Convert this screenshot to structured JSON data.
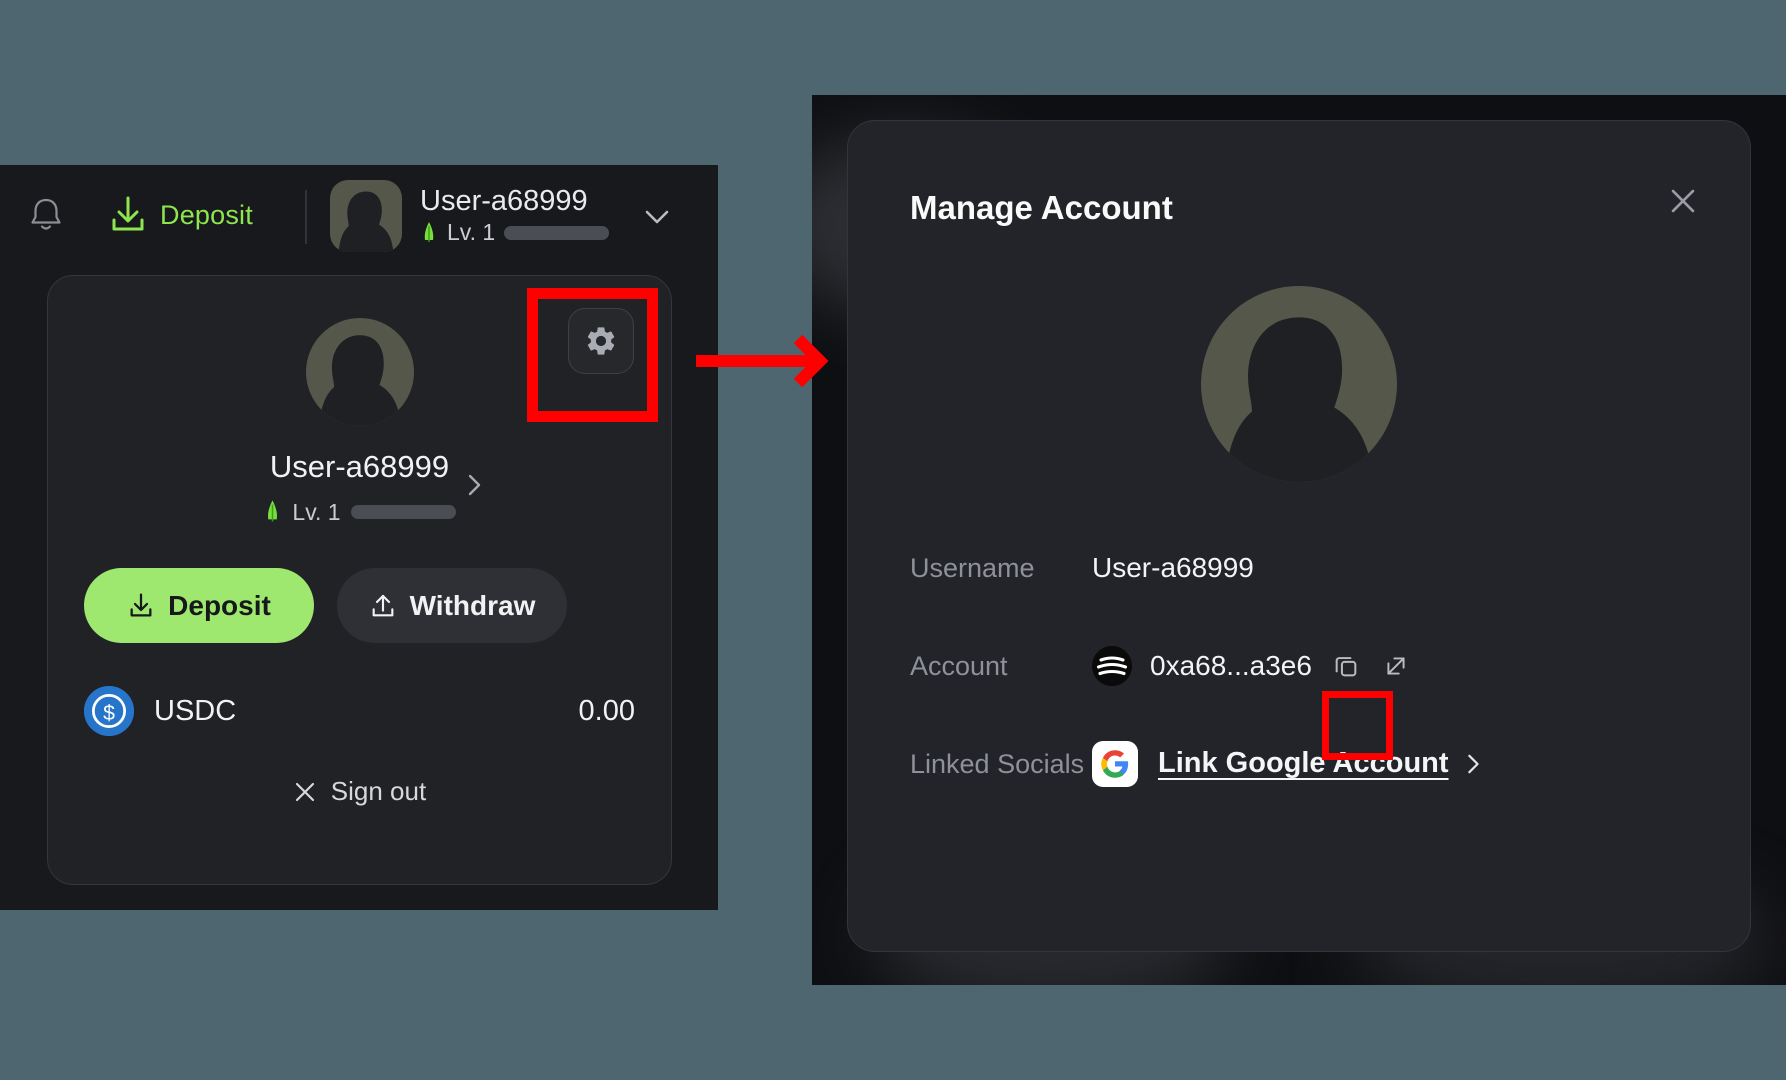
{
  "colors": {
    "background": "#4d6670",
    "panel": "#18191c",
    "card": "#212226",
    "modal": "#222429",
    "accent_green": "#9fe870",
    "deposit_link_green": "#8ee64f",
    "usdc_blue": "#2775ca",
    "annotation_red": "#ff0000",
    "avatar_olive": "#55574a",
    "muted_text": "#8e9197"
  },
  "left_panel": {
    "topbar": {
      "bell_icon": "bell-icon",
      "deposit_label": "Deposit",
      "deposit_icon": "download-icon",
      "user_name": "User-a68999",
      "level_label": "Lv. 1",
      "level_icon": "sprout-icon",
      "chevron_icon": "chevron-down-icon",
      "avatar_icon": "user-avatar"
    },
    "account_card": {
      "gear_icon": "gear-icon",
      "avatar_icon": "user-avatar",
      "user_name": "User-a68999",
      "level_label": "Lv. 1",
      "level_icon": "sprout-icon",
      "profile_chevron_icon": "chevron-right-icon",
      "deposit_button": {
        "label": "Deposit",
        "icon": "download-icon"
      },
      "withdraw_button": {
        "label": "Withdraw",
        "icon": "upload-icon"
      },
      "token": {
        "icon": "usdc-icon",
        "symbol": "USDC",
        "amount": "0.00"
      },
      "sign_out": {
        "label": "Sign out",
        "icon": "close-x-icon"
      }
    }
  },
  "modal": {
    "title": "Manage Account",
    "close_icon": "close-icon",
    "avatar_icon": "user-avatar",
    "fields": [
      {
        "label": "Username",
        "value": "User-a68999"
      },
      {
        "label": "Account",
        "value": "0xa68...a3e6",
        "chain_icon": "abstract-chain-icon",
        "copy_icon": "copy-icon",
        "external_icon": "external-link-icon"
      },
      {
        "label": "Linked Socials",
        "value": "Link Google Account",
        "provider_icon": "google-icon",
        "chevron_icon": "chevron-right-icon"
      }
    ]
  },
  "annotations": {
    "gear_highlight": "red-box-around-gear-button",
    "copy_highlight": "red-box-around-copy-button",
    "arrow": "red-arrow-pointing-right"
  }
}
